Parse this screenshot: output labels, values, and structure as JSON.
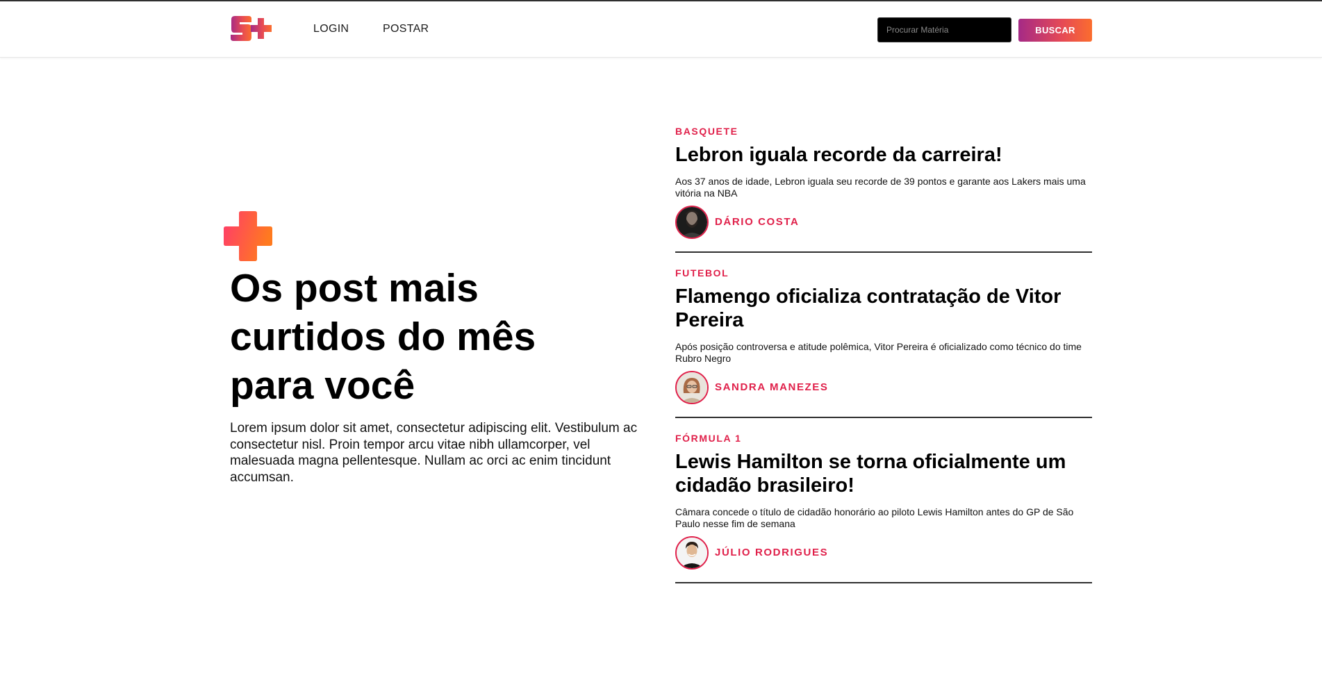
{
  "header": {
    "logo_text": "S+",
    "nav": {
      "login_label": "LOGIN",
      "postar_label": "POSTAR"
    },
    "search": {
      "placeholder": "Procurar Matéria",
      "value": "",
      "button_label": "BUSCAR"
    }
  },
  "hero": {
    "plus_icon": "plus-icon",
    "title": "Os post mais curtidos do mês para você",
    "text": "Lorem ipsum dolor sit amet, consectetur adipiscing elit. Vestibulum ac consectetur nisl. Proin tempor arcu vitae nibh ullamcorper, vel malesuada magna pellentesque. Nullam ac orci ac enim tincidunt accumsan."
  },
  "posts": [
    {
      "category": "BASQUETE",
      "title": "Lebron iguala recorde da carreira!",
      "description": "Aos 37 anos de idade, Lebron iguala seu recorde de 39 pontos e garante aos Lakers mais uma vitória na NBA",
      "author": "DÁRIO COSTA"
    },
    {
      "category": "FUTEBOL",
      "title": "Flamengo oficializa contratação de Vitor Pereira",
      "description": "Após posição controversa e atitude polêmica, Vitor Pereira é oficializado como técnico do time Rubro Negro",
      "author": "SANDRA MANEZES"
    },
    {
      "category": "FÓRMULA 1",
      "title": "Lewis Hamilton se torna oficialmente um cidadão brasileiro!",
      "description": "Câmara concede o título de cidadão honorário ao piloto Lewis Hamilton antes do GP de São Paulo nesse fim de semana",
      "author": "JÚLIO RODRIGUES"
    }
  ],
  "colors": {
    "accent": "#e0204a",
    "gradient_start": "#a52a86",
    "gradient_end": "#fb6d2e",
    "search_bg": "#000000"
  }
}
